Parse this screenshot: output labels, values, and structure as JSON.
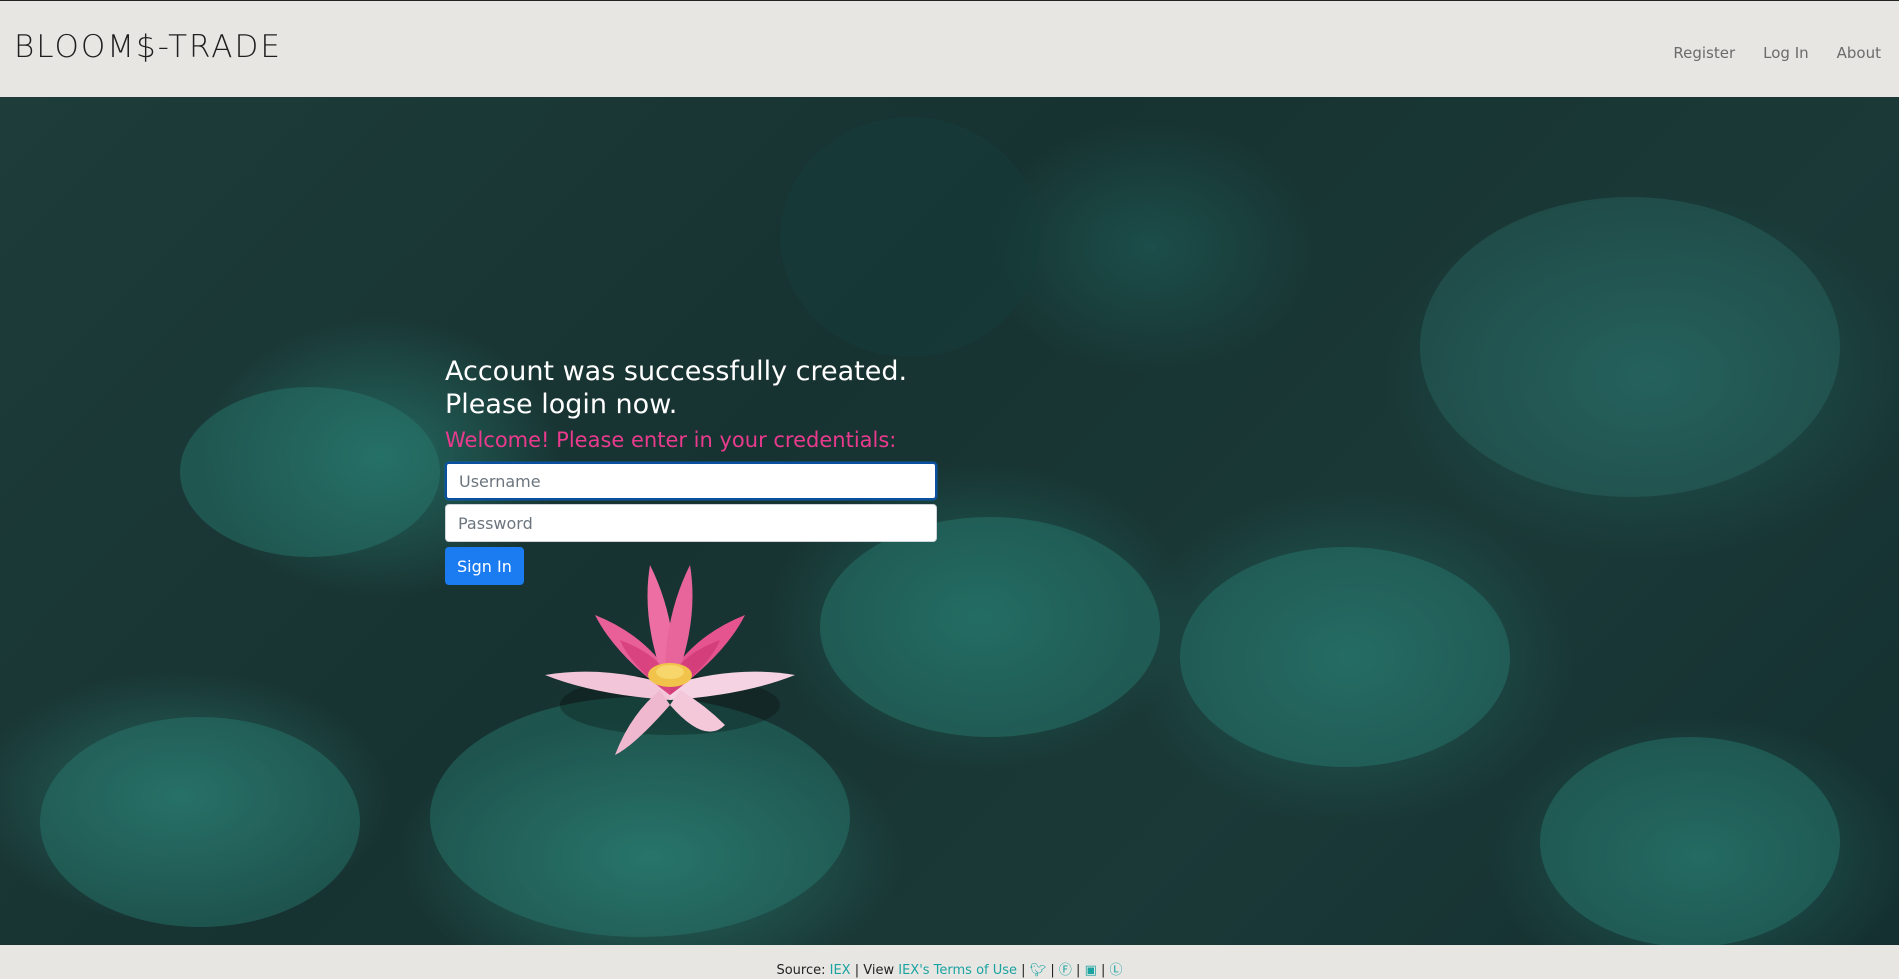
{
  "header": {
    "brand": "BLOOM$-TRADE",
    "nav": {
      "register": "Register",
      "login": "Log In",
      "about": "About"
    }
  },
  "login": {
    "success_line1": "Account was successfully created.",
    "success_line2": "Please login now.",
    "welcome": "Welcome! Please enter in your credentials:",
    "username_placeholder": "Username",
    "password_placeholder": "Password",
    "signin_label": "Sign In"
  },
  "footer": {
    "source_prefix": "Source:",
    "source_link": "IEX",
    "view_prefix": "| View",
    "terms_link": "IEX's Terms of Use",
    "separator": "|",
    "icons": [
      "twitter-icon",
      "facebook-icon",
      "instagram-icon",
      "linkedin-icon"
    ]
  },
  "colors": {
    "accent_pink": "#e93a8d",
    "button_blue": "#1b7cf2",
    "link_teal": "#1aa3a1",
    "header_bg": "#e8e6e2"
  }
}
